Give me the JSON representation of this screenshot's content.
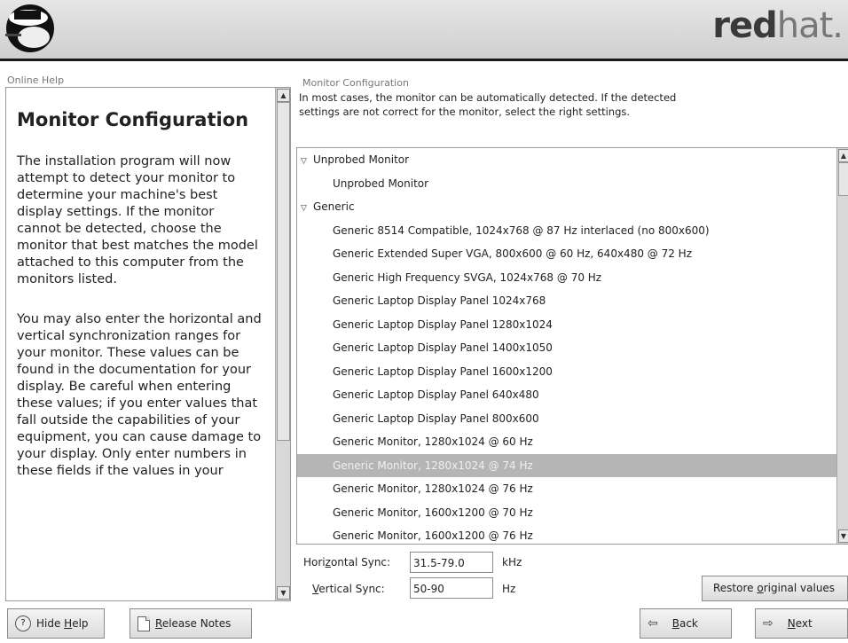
{
  "header": {
    "brand_bold": "red",
    "brand_light": "hat."
  },
  "help": {
    "frame_title": "Online Help",
    "heading": "Monitor Configuration",
    "paragraph1": "The installation program will now attempt to detect your monitor to determine your machine's best display settings. If the monitor cannot be detected, choose the monitor that best matches the model attached to this computer from the monitors listed.",
    "paragraph2": "You may also enter the horizontal and vertical synchronization ranges for your monitor. These values can be found in the documentation for your display. Be careful when entering these values; if you enter values that fall outside the capabilities of your equipment, you can cause damage to your display. Only enter numbers in these fields if the values in your"
  },
  "monitor": {
    "frame_title": "Monitor Configuration",
    "intro": "In most cases, the monitor can be automatically detected. If the detected settings are not correct for the monitor, select the right settings.",
    "rows": [
      {
        "type": "group",
        "label": "Unprobed Monitor"
      },
      {
        "type": "item",
        "label": "Unprobed Monitor"
      },
      {
        "type": "group",
        "label": "Generic"
      },
      {
        "type": "item",
        "label": "Generic 8514 Compatible, 1024x768 @ 87 Hz interlaced (no 800x600)"
      },
      {
        "type": "item",
        "label": "Generic Extended Super VGA, 800x600 @ 60 Hz, 640x480 @ 72 Hz"
      },
      {
        "type": "item",
        "label": "Generic High Frequency SVGA, 1024x768 @ 70 Hz"
      },
      {
        "type": "item",
        "label": "Generic Laptop Display Panel 1024x768"
      },
      {
        "type": "item",
        "label": "Generic Laptop Display Panel 1280x1024"
      },
      {
        "type": "item",
        "label": "Generic Laptop Display Panel 1400x1050"
      },
      {
        "type": "item",
        "label": "Generic Laptop Display Panel 1600x1200"
      },
      {
        "type": "item",
        "label": "Generic Laptop Display Panel 640x480"
      },
      {
        "type": "item",
        "label": "Generic Laptop Display Panel 800x600"
      },
      {
        "type": "item",
        "label": "Generic Monitor, 1280x1024 @ 60 Hz"
      },
      {
        "type": "item",
        "label": "Generic Monitor, 1280x1024 @ 74 Hz",
        "selected": true
      },
      {
        "type": "item",
        "label": "Generic Monitor, 1280x1024 @ 76 Hz"
      },
      {
        "type": "item",
        "label": "Generic Monitor, 1600x1200 @ 70 Hz"
      },
      {
        "type": "item",
        "label": "Generic Monitor, 1600x1200 @ 76 Hz"
      }
    ],
    "hsync": {
      "label_pre": "Hori",
      "label_u": "z",
      "label_post": "ontal Sync:",
      "value": "31.5-79.0",
      "unit": "kHz"
    },
    "vsync": {
      "label_u": "V",
      "label_post": "ertical Sync:",
      "value": "50-90",
      "unit": "Hz"
    },
    "restore": {
      "pre": "Restore ",
      "u": "o",
      "post": "riginal values"
    }
  },
  "footer": {
    "hide_help": {
      "pre": "Hide ",
      "u": "H",
      "post": "elp"
    },
    "release_notes": {
      "u": "R",
      "post": "elease Notes"
    },
    "back": {
      "u": "B",
      "post": "ack"
    },
    "next": {
      "u": "N",
      "post": "ext"
    }
  }
}
